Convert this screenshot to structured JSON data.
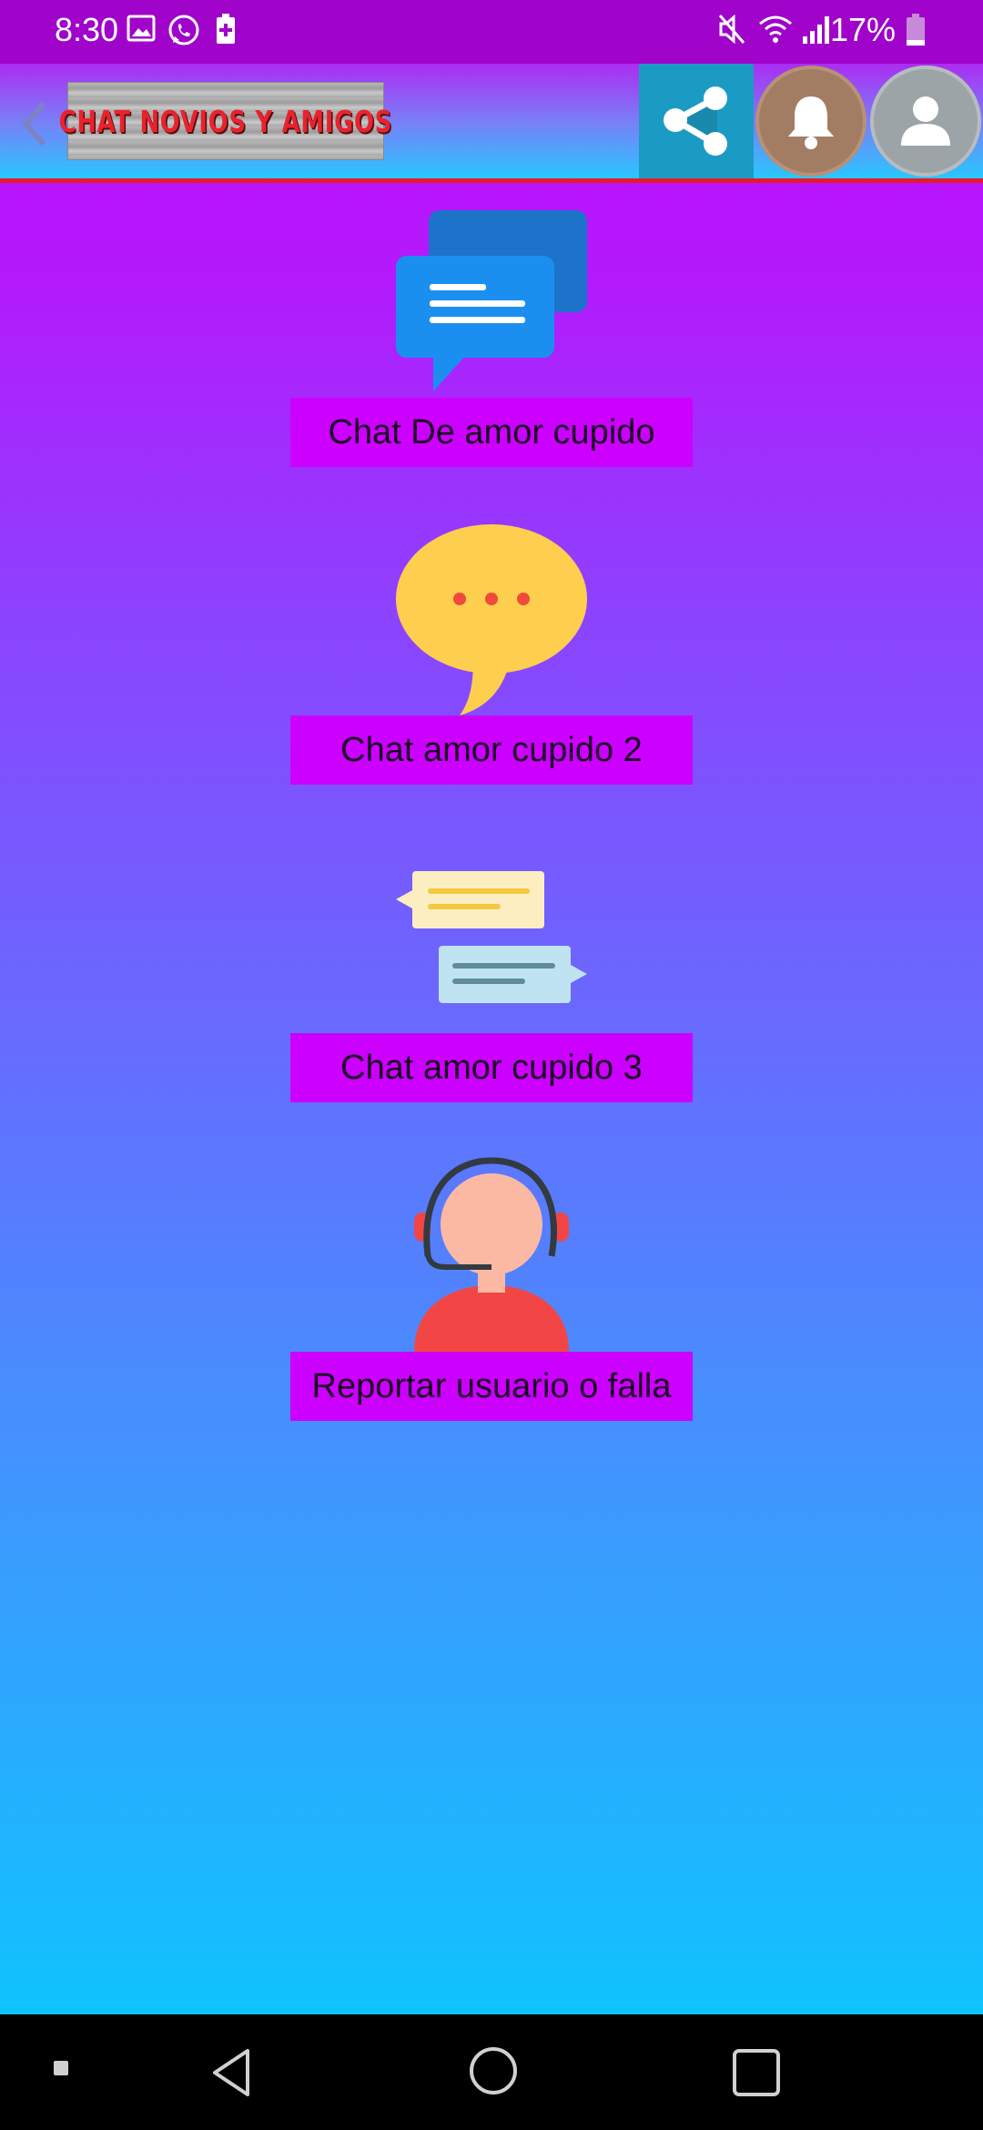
{
  "status_bar": {
    "time": "8:30",
    "battery": "17%",
    "icons": [
      "gallery-icon",
      "whatsapp-icon",
      "battery-saver-icon",
      "mute-icon",
      "wifi-icon",
      "signal-icon",
      "battery-icon"
    ]
  },
  "app_bar": {
    "logo_text": "CHAT NOVIOS Y AMIGOS",
    "back_icon": "chevron-left-icon",
    "share_icon": "share-icon",
    "bell_icon": "bell-icon",
    "profile_icon": "profile-icon"
  },
  "menu": [
    {
      "label": "Chat De amor cupido",
      "icon": "chat-bubbles-icon"
    },
    {
      "label": "Chat amor cupido 2",
      "icon": "speech-bubble-icon"
    },
    {
      "label": "Chat amor cupido 3",
      "icon": "messages-icon"
    },
    {
      "label": "Reportar usuario o falla",
      "icon": "support-agent-icon"
    }
  ],
  "nav_bar": {
    "icons": [
      "menu-dot-icon",
      "back-triangle-icon",
      "home-circle-icon",
      "recents-square-icon"
    ]
  },
  "colors": {
    "status_bar": "#a003c9",
    "button": "#cc00ff",
    "share": "#1b9bc4",
    "accent_line": "#e6192a"
  }
}
